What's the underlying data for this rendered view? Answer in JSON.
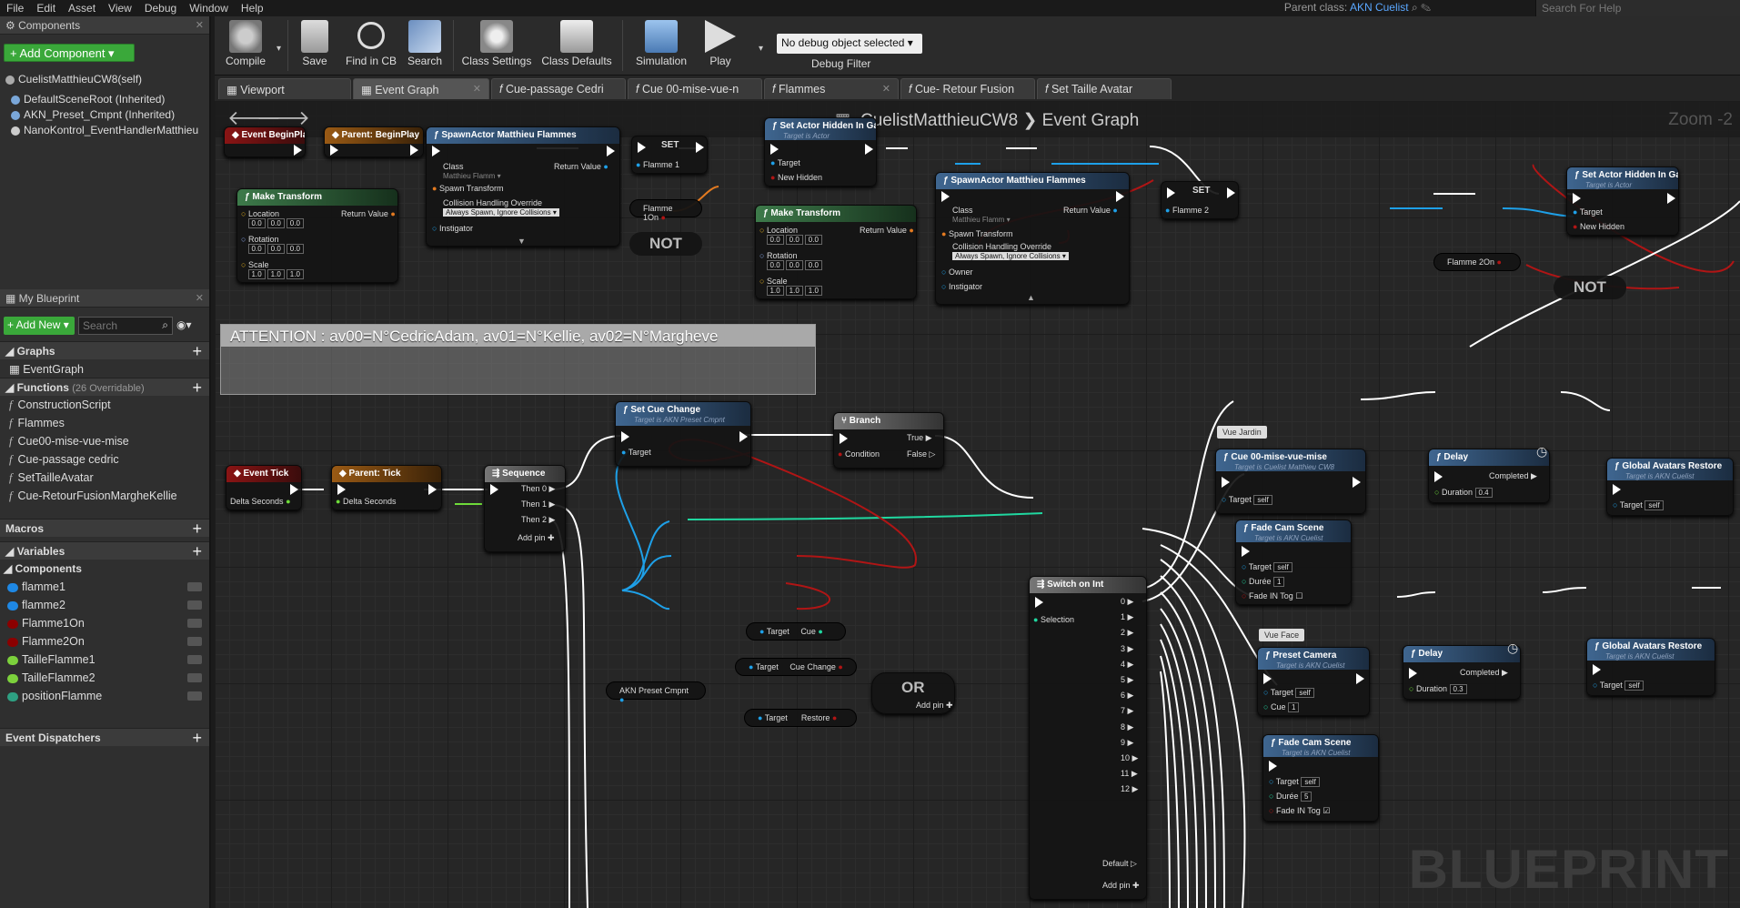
{
  "menu": [
    "File",
    "Edit",
    "Asset",
    "View",
    "Debug",
    "Window",
    "Help"
  ],
  "parent_class_label": "Parent class:",
  "parent_class_value": "AKN Cuelist",
  "help_search_placeholder": "Search For Help",
  "components_tab": "Components",
  "add_component": "+ Add Component ▾",
  "component_self": "CuelistMatthieuCW8(self)",
  "components": [
    "DefaultSceneRoot (Inherited)",
    "AKN_Preset_Cmpnt (Inherited)",
    "NanoKontrol_EventHandlerMatthieu"
  ],
  "my_blueprint_tab": "My Blueprint",
  "add_new": "+ Add New ▾",
  "search_placeholder": "Search",
  "graphs_label": "Graphs",
  "event_graph": "EventGraph",
  "functions_label": "Functions",
  "functions_overridable": "(26 Overridable)",
  "functions": [
    "ConstructionScript",
    "Flammes",
    "Cue00-mise-vue-mise",
    "Cue-passage cedric",
    "SetTailleAvatar",
    "Cue-RetourFusionMargheKellie"
  ],
  "macros_label": "Macros",
  "variables_label": "Variables",
  "components_cat": "Components",
  "variables": [
    {
      "name": "flamme1",
      "color": "#1e88e5"
    },
    {
      "name": "flamme2",
      "color": "#1e88e5"
    },
    {
      "name": "Flamme1On",
      "color": "#8b0000"
    },
    {
      "name": "Flamme2On",
      "color": "#8b0000"
    },
    {
      "name": "TailleFlamme1",
      "color": "#7cd13c"
    },
    {
      "name": "TailleFlamme2",
      "color": "#7cd13c"
    },
    {
      "name": "positionFlamme",
      "color": "#2ea082"
    }
  ],
  "event_dispatchers": "Event Dispatchers",
  "toolbar": [
    "Compile",
    "Save",
    "Find in CB",
    "Search",
    "Class Settings",
    "Class Defaults",
    "Simulation",
    "Play"
  ],
  "debug_select": "No debug object selected ▾",
  "debug_filter": "Debug Filter",
  "tabs": [
    "Viewport",
    "Event Graph",
    "Cue-passage Cedri",
    "Cue 00-mise-vue-n",
    "Flammes",
    "Cue- Retour Fusion",
    "Set Taille Avatar"
  ],
  "breadcrumb": "CuelistMatthieuCW8 ❯ Event Graph",
  "zoom": "Zoom -2",
  "watermark": "BLUEPRINT",
  "comment": "ATTENTION : av00=N°CedricAdam, av01=N°Kellie, av02=N°Margheve",
  "nodes": {
    "begin_play": "Event BeginPlay",
    "parent_begin": "Parent: BeginPlay",
    "spawn1": "SpawnActor Matthieu Flammes",
    "spawn2": "SpawnActor Matthieu Flammes",
    "set": "SET",
    "flamme1": "Flamme 1",
    "flamme2": "Flamme 2",
    "hidden1": "Set Actor Hidden In Game",
    "hidden2": "Set Actor Hidden In Game",
    "target_actor": "Target is Actor",
    "make_transform": "Make Transform",
    "flamme1on": "Flamme 1On",
    "flamme2on": "Flamme 2On",
    "not": "NOT",
    "event_tick": "Event Tick",
    "parent_tick": "Parent: Tick",
    "sequence": "Sequence",
    "set_cue_change": "Set Cue Change",
    "target_preset": "Target is AKN Preset Cmpnt",
    "branch": "Branch",
    "switch": "Switch on Int",
    "preset_cmpnt": "AKN Preset Cmpnt",
    "or": "OR",
    "cue00": "Cue 00-mise-vue-mise",
    "target_cuelist": "Target is Cuelist Matthieu CW8",
    "delay": "Delay",
    "global_restore": "Global Avatars Restore",
    "target_akn": "Target is AKN Cuelist",
    "fade": "Fade Cam Scene",
    "preset_camera": "Preset Camera",
    "vue_jardin": "Vue Jardin",
    "vue_face": "Vue Face"
  },
  "pins": {
    "class": "Class",
    "class_val": "Matthieu Flamm ▾",
    "spawn_transform": "Spawn Transform",
    "collision": "Collision Handling Override",
    "collision_val": "Always Spawn, Ignore Collisions ▾",
    "instigator": "Instigator",
    "owner": "Owner",
    "return_value": "Return Value",
    "target": "Target",
    "new_hidden": "New Hidden",
    "location": "Location",
    "rotation": "Rotation",
    "scale": "Scale",
    "delta_seconds": "Delta Seconds",
    "then0": "Then 0",
    "then1": "Then 1",
    "then2": "Then 2",
    "add_pin": "Add pin",
    "true": "True",
    "false": "False",
    "condition": "Condition",
    "selection": "Selection",
    "default": "Default",
    "cue": "Cue",
    "cue_change": "Cue Change",
    "restore": "Restore",
    "completed": "Completed",
    "duration": "Duration",
    "duree": "Durée",
    "fade_in_tog": "Fade IN Tog",
    "self": "self"
  },
  "values": {
    "zero": "0.0",
    "one": "1.0",
    "delay1": "0.4",
    "delay2": "0.3",
    "duree1": "1",
    "cue_val": "1",
    "duree2": "5"
  }
}
